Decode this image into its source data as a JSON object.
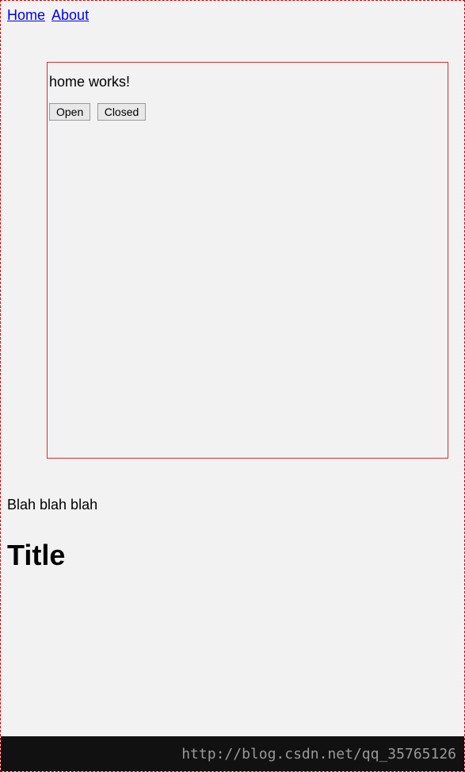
{
  "nav": {
    "home_label": "Home",
    "about_label": "About"
  },
  "content": {
    "heading": "home works!",
    "open_button": "Open",
    "closed_button": "Closed"
  },
  "footer": {
    "text": "Blah blah blah",
    "title": "Title"
  },
  "watermark": {
    "url": "http://blog.csdn.net/qq_35765126"
  }
}
